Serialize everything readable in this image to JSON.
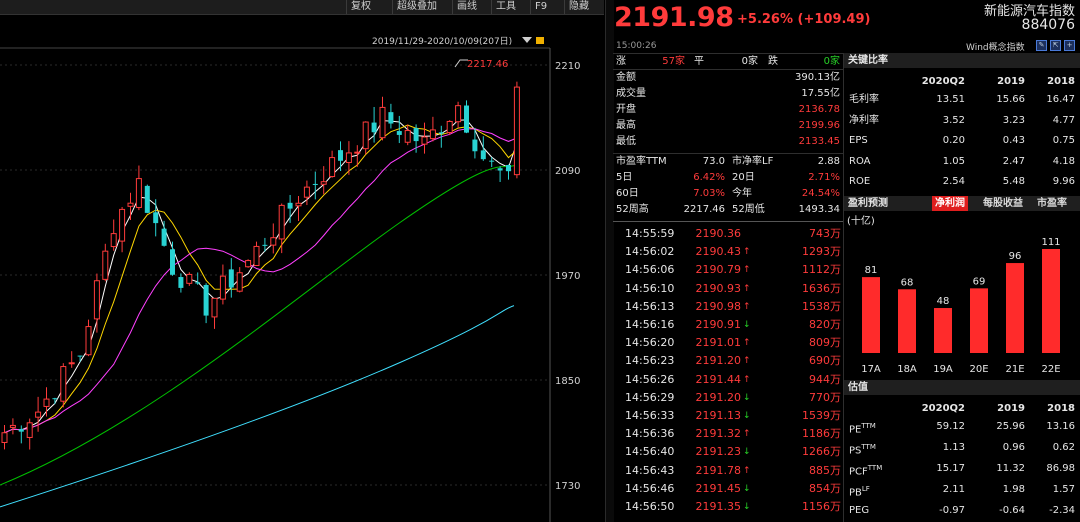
{
  "toolbar": {
    "items": [
      "复权",
      "超级叠加",
      "画线",
      "工具",
      "F9",
      "隐藏"
    ]
  },
  "chart": {
    "period_label": "2019/11/29-2020/10/09(207日)",
    "high_label": "2217.46",
    "y_ticks": [
      "2210",
      "2090",
      "1970",
      "1850",
      "1730"
    ],
    "up_color": "#ff3b3b",
    "down_color": "#29d3d3",
    "ma_colors": [
      "#ffffff",
      "#ffd700",
      "#ff40ff",
      "#00c000",
      "#40e0ff"
    ]
  },
  "chart_data": {
    "type": "candlestick",
    "y_axis_ticks": [
      2210,
      2090,
      1970,
      1850,
      1730
    ],
    "high": 2217.46
  },
  "header": {
    "price": "2191.98",
    "change": "+5.26% (+109.49)",
    "name": "新能源汽车指数",
    "code": "884076",
    "time": "15:00:26",
    "wind_label": "Wind概念指数",
    "accent_color": "#ff3b3b"
  },
  "stats": {
    "breadth": {
      "up_label": "涨",
      "up_count": "57家",
      "flat_label": "平",
      "flat_count": "0家",
      "down_label": "跌",
      "down_count": "0家"
    },
    "rows": [
      {
        "label": "金额",
        "value": "390.13亿",
        "color": "white"
      },
      {
        "label": "成交量",
        "value": "17.55亿",
        "color": "white"
      },
      {
        "label": "开盘",
        "value": "2136.78",
        "color": "red"
      },
      {
        "label": "最高",
        "value": "2199.96",
        "color": "red"
      },
      {
        "label": "最低",
        "value": "2133.45",
        "color": "red"
      }
    ],
    "grid": [
      {
        "l1": "市盈率TTM",
        "v1": "73.0",
        "c1": "white",
        "l2": "市净率LF",
        "v2": "2.88",
        "c2": "white"
      },
      {
        "l1": "5日",
        "v1": "6.42%",
        "c1": "red",
        "l2": "20日",
        "v2": "2.71%",
        "c2": "red"
      },
      {
        "l1": "60日",
        "v1": "7.03%",
        "c1": "red",
        "l2": "今年",
        "v2": "24.54%",
        "c2": "red"
      },
      {
        "l1": "52周高",
        "v1": "2217.46",
        "c1": "white",
        "l2": "52周低",
        "v2": "1493.34",
        "c2": "white"
      }
    ]
  },
  "ticks": [
    {
      "time": "14:55:59",
      "price": "2190.36",
      "dir": "",
      "vol": "743万"
    },
    {
      "time": "14:56:02",
      "price": "2190.43",
      "dir": "up",
      "vol": "1293万"
    },
    {
      "time": "14:56:06",
      "price": "2190.79",
      "dir": "up",
      "vol": "1112万"
    },
    {
      "time": "14:56:10",
      "price": "2190.93",
      "dir": "up",
      "vol": "1636万"
    },
    {
      "time": "14:56:13",
      "price": "2190.98",
      "dir": "up",
      "vol": "1538万"
    },
    {
      "time": "14:56:16",
      "price": "2190.91",
      "dir": "down",
      "vol": "820万"
    },
    {
      "time": "14:56:20",
      "price": "2191.01",
      "dir": "up",
      "vol": "809万"
    },
    {
      "time": "14:56:23",
      "price": "2191.20",
      "dir": "up",
      "vol": "690万"
    },
    {
      "time": "14:56:26",
      "price": "2191.44",
      "dir": "up",
      "vol": "944万"
    },
    {
      "time": "14:56:29",
      "price": "2191.20",
      "dir": "down",
      "vol": "770万"
    },
    {
      "time": "14:56:33",
      "price": "2191.13",
      "dir": "down",
      "vol": "1539万"
    },
    {
      "time": "14:56:36",
      "price": "2191.32",
      "dir": "up",
      "vol": "1186万"
    },
    {
      "time": "14:56:40",
      "price": "2191.23",
      "dir": "down",
      "vol": "1266万"
    },
    {
      "time": "14:56:43",
      "price": "2191.78",
      "dir": "up",
      "vol": "885万"
    },
    {
      "time": "14:56:46",
      "price": "2191.45",
      "dir": "down",
      "vol": "854万"
    },
    {
      "time": "14:56:50",
      "price": "2191.35",
      "dir": "down",
      "vol": "1156万"
    }
  ],
  "key_ratios": {
    "title": "关键比率",
    "years": [
      "2020Q2",
      "2019",
      "2018"
    ],
    "rows": [
      {
        "label": "毛利率",
        "values": [
          "13.51",
          "15.66",
          "16.47"
        ]
      },
      {
        "label": "净利率",
        "values": [
          "3.52",
          "3.23",
          "4.77"
        ]
      },
      {
        "label": "EPS",
        "values": [
          "0.20",
          "0.43",
          "0.75"
        ]
      },
      {
        "label": "ROA",
        "values": [
          "1.05",
          "2.47",
          "4.18"
        ]
      },
      {
        "label": "ROE",
        "values": [
          "2.54",
          "5.48",
          "9.96"
        ]
      }
    ]
  },
  "forecast": {
    "title": "盈利预测",
    "tabs": [
      "净利润",
      "每股收益",
      "市盈率"
    ],
    "unit": "(十亿)",
    "bar_color": "#ff2b2b",
    "categories": [
      "17A",
      "18A",
      "19A",
      "20E",
      "21E",
      "22E"
    ],
    "values": [
      81,
      68,
      48,
      69,
      96,
      111
    ]
  },
  "valuation": {
    "title": "估值",
    "years": [
      "2020Q2",
      "2019",
      "2018"
    ],
    "rows": [
      {
        "label": "PE",
        "sup": "TTM",
        "values": [
          "59.12",
          "25.96",
          "13.16"
        ]
      },
      {
        "label": "PS",
        "sup": "TTM",
        "values": [
          "1.13",
          "0.96",
          "0.62"
        ]
      },
      {
        "label": "PCF",
        "sup": "TTM",
        "values": [
          "15.17",
          "11.32",
          "86.98"
        ]
      },
      {
        "label": "PB",
        "sup": "LF",
        "values": [
          "2.11",
          "1.98",
          "1.57"
        ]
      },
      {
        "label": "PEG",
        "sup": "",
        "values": [
          "-0.97",
          "-0.64",
          "-2.34"
        ]
      }
    ]
  }
}
